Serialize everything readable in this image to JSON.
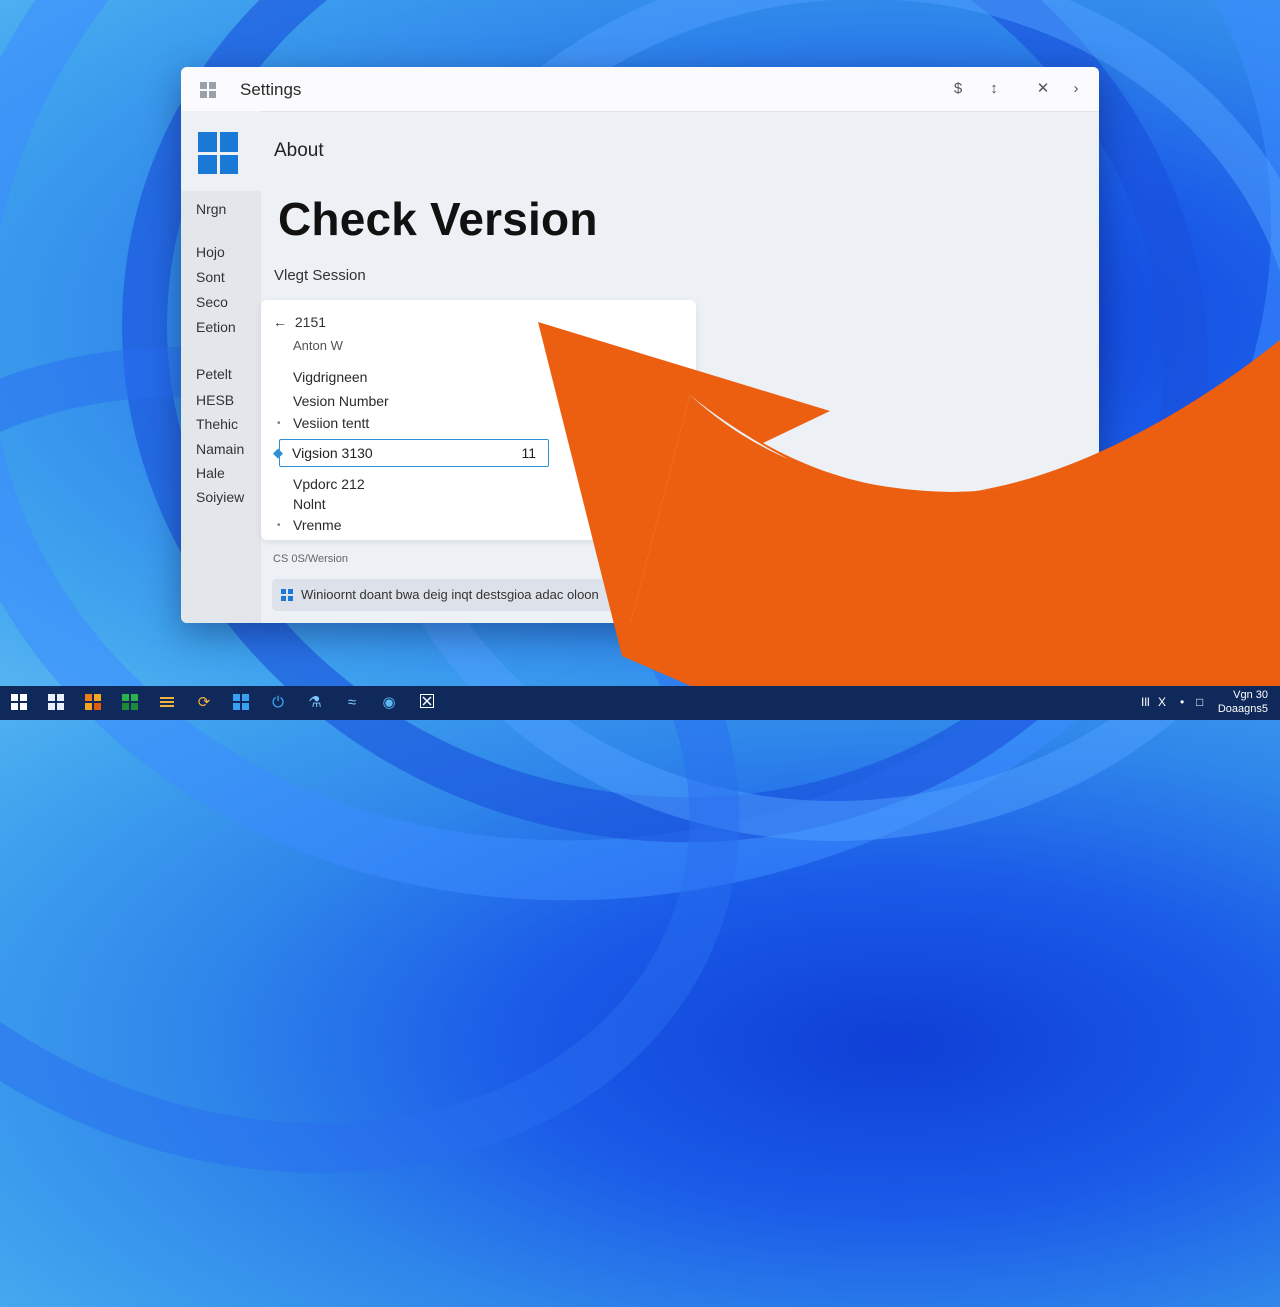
{
  "window": {
    "title": "Settings",
    "controls": [
      "$",
      "↕",
      "✕",
      "›"
    ]
  },
  "sidebar": {
    "items": [
      {
        "label": "Nrgn"
      },
      {
        "label": "Hojo"
      },
      {
        "label": "Sont"
      },
      {
        "label": "Seco"
      },
      {
        "label": "Eetion"
      },
      {
        "label": "Petelt"
      },
      {
        "label": "HESB"
      },
      {
        "label": "Thehic"
      },
      {
        "label": "Namain"
      },
      {
        "label": "Hale"
      },
      {
        "label": "Soiyiew"
      }
    ]
  },
  "main": {
    "page": "About",
    "headline": "Check Version",
    "subhead": "Vlegt Session"
  },
  "card": {
    "back_label": "2151",
    "sub_label": "Anton W",
    "items": [
      {
        "label": "Vigdrigneen"
      },
      {
        "label": "Vesion Number"
      },
      {
        "label": "Vesiion tentt"
      }
    ],
    "highlight": {
      "label": "Vigsion  3130",
      "value": "11"
    },
    "items_after": [
      {
        "label": "Vpdorc 212"
      },
      {
        "label": "Nolnt"
      },
      {
        "label": "Vrenme"
      }
    ]
  },
  "footer": {
    "os_label": "CS 0S/Wersion",
    "banner_text": "Winioornt doant bwa deig inqt destsgioa adac oloon"
  },
  "taskbar": {
    "tray": [
      "Ill",
      "X",
      "•",
      "□"
    ],
    "clock_line1": "Vgn 30",
    "clock_line2": "Doaagns5"
  },
  "colors": {
    "accent": "#1a78d6",
    "arrow": "#ec5e10",
    "highlight_border": "#2d8fd5"
  }
}
